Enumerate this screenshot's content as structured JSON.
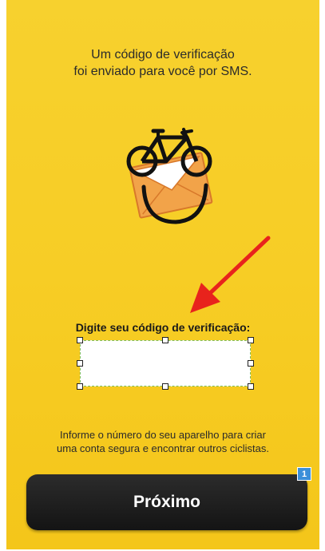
{
  "header": {
    "line1": "Um código de verificação",
    "line2": "foi enviado para você por SMS."
  },
  "logo": {
    "icon": "bicycle-envelope-smiley-icon"
  },
  "annotation": {
    "icon": "red-arrow-icon",
    "color": "#e8231c"
  },
  "code": {
    "label": "Digite seu código de verificação:",
    "value": "",
    "placeholder": ""
  },
  "info": {
    "line1": "Informe o número do seu aparelho para criar",
    "line2": "uma conta segura e encontrar outros ciclistas."
  },
  "next_button": {
    "label": "Próximo"
  },
  "badge": {
    "value": "1",
    "color": "#3b8fd9"
  },
  "colors": {
    "background": "#f7cd25",
    "button": "#1a1a1a"
  }
}
